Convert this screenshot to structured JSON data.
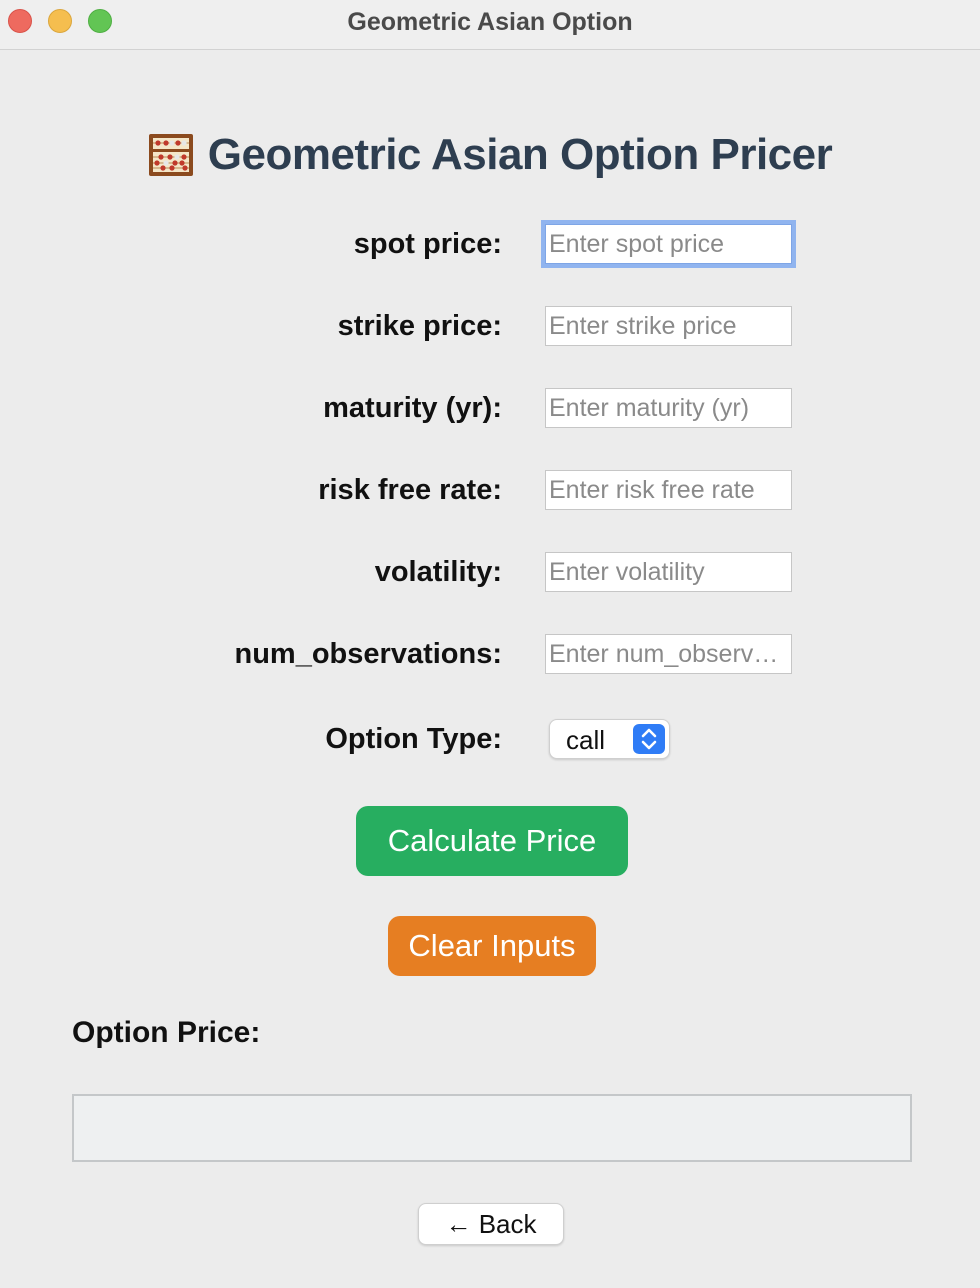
{
  "window": {
    "title": "Geometric Asian Option"
  },
  "header": {
    "icon": "abacus-icon",
    "title": "Geometric Asian Option Pricer"
  },
  "form": {
    "fields": [
      {
        "label": "spot price:",
        "placeholder": "Enter spot price",
        "value": ""
      },
      {
        "label": "strike price:",
        "placeholder": "Enter strike price",
        "value": ""
      },
      {
        "label": "maturity (yr):",
        "placeholder": "Enter maturity (yr)",
        "value": ""
      },
      {
        "label": "risk free rate:",
        "placeholder": "Enter risk free rate",
        "value": ""
      },
      {
        "label": "volatility:",
        "placeholder": "Enter volatility",
        "value": ""
      },
      {
        "label": "num_observations:",
        "placeholder": "Enter num_observ…",
        "value": ""
      }
    ],
    "option_type": {
      "label": "Option Type:",
      "selected": "call"
    }
  },
  "buttons": {
    "calculate": "Calculate Price",
    "clear": "Clear Inputs",
    "back": "← Back"
  },
  "result": {
    "label": "Option Price:",
    "value": ""
  },
  "colors": {
    "calculate_bg": "#27ae60",
    "clear_bg": "#e67e22",
    "title_color": "#2e3e50",
    "focus_ring": "#90b4ef"
  }
}
